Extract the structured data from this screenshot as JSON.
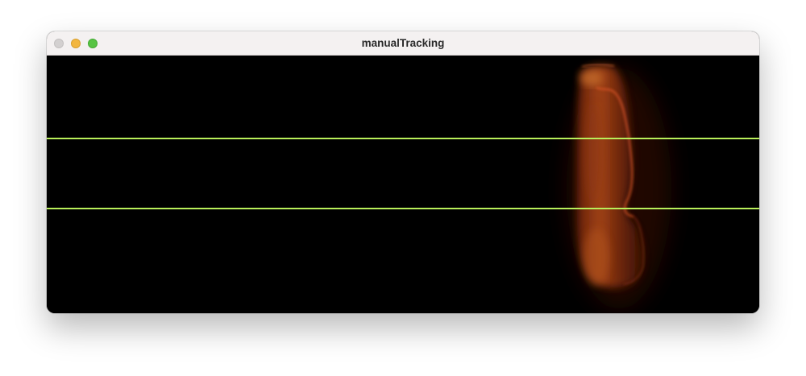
{
  "window": {
    "title": "manualTracking",
    "controls": {
      "close": "close-icon",
      "minimize": "minimize-icon",
      "maximize": "maximize-icon"
    }
  },
  "viewport": {
    "background": "#000000",
    "guide_line_color": "#b8ef5a",
    "guide_line_count": 2,
    "specimen_color": "#c2531c"
  }
}
